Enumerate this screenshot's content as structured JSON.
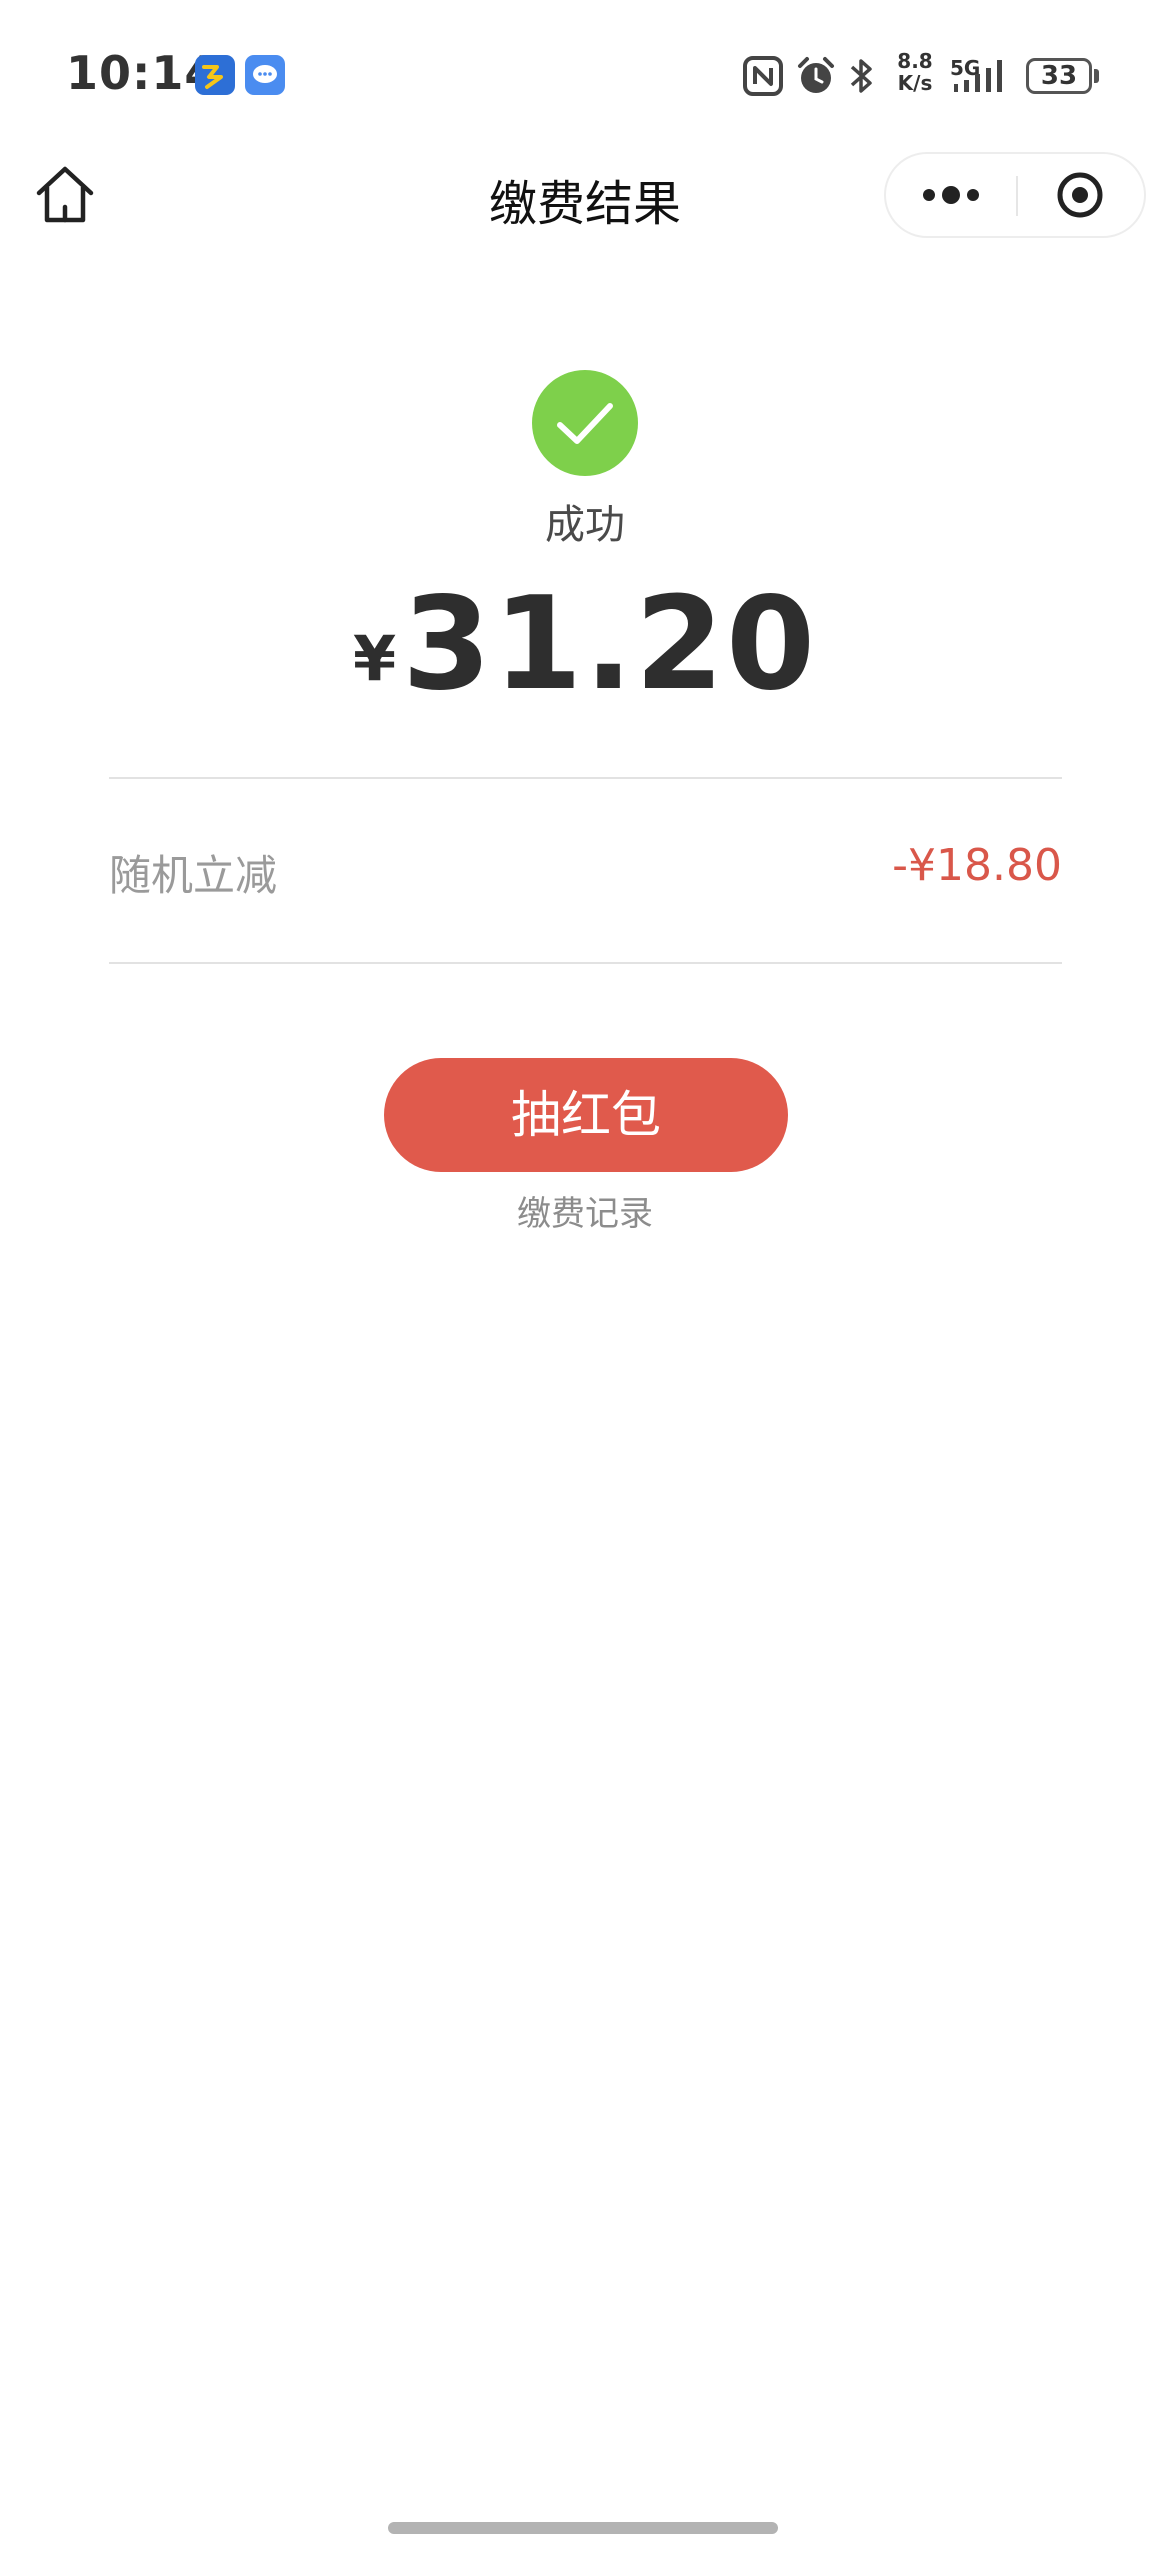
{
  "status_bar": {
    "time": "10:14",
    "net_speed_value": "8.8",
    "net_speed_unit": "K/s",
    "network_type": "5G",
    "battery_level": "33",
    "icons": [
      "app-notification-icon",
      "message-icon",
      "nfc-icon",
      "alarm-icon",
      "bluetooth-icon",
      "signal-icon",
      "battery-icon"
    ]
  },
  "nav": {
    "title": "缴费结果",
    "home_icon": "home-icon",
    "more_icon": "more-dots-icon",
    "close_icon": "target-circle-icon"
  },
  "result": {
    "status_label": "成功",
    "currency": "¥",
    "amount": "31.20",
    "success_color": "#7ed04b"
  },
  "discount": {
    "label": "随机立减",
    "value": "-¥18.80",
    "value_color": "#d9574a"
  },
  "actions": {
    "red_packet_label": "抽红包",
    "red_packet_color": "#e05a4c",
    "records_label": "缴费记录"
  }
}
